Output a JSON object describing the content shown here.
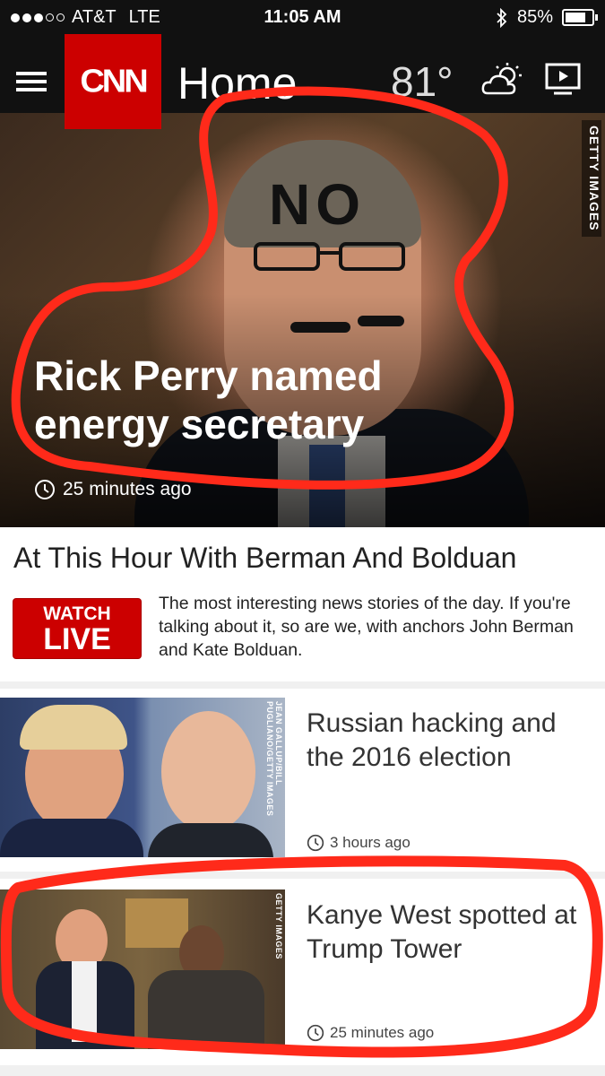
{
  "status_bar": {
    "carrier": "AT&T",
    "network": "LTE",
    "time": "11:05 AM",
    "battery": "85%"
  },
  "header": {
    "logo": "CNN",
    "page_name": "Home",
    "temperature": "81°",
    "weather_icon": "partly-cloudy-icon",
    "video_icon": "tv-play-icon"
  },
  "hero": {
    "title": "Rick Perry named energy secretary",
    "time": "25 minutes ago",
    "credit": "GETTY IMAGES",
    "annotation_text": "NO"
  },
  "section": {
    "title": "At This Hour With Berman And Bolduan",
    "watch_label": "WATCH",
    "live_label": "LIVE",
    "description": "The most interesting news stories of the day. If you're talking about it, so are we, with anchors John Berman and Kate Bolduan."
  },
  "stories": [
    {
      "title": "Russian hacking and the 2016 election",
      "time": "3 hours ago",
      "credit": "JEAN GALLUP/BILL PUGLIANO/GETTY IMAGES"
    },
    {
      "title": "Kanye West spotted at Trump Tower",
      "time": "25 minutes ago",
      "credit": "GETTY IMAGES"
    }
  ],
  "colors": {
    "brand_red": "#cc0000",
    "header_bg": "#111111",
    "marker_red": "#ff2a1a"
  }
}
